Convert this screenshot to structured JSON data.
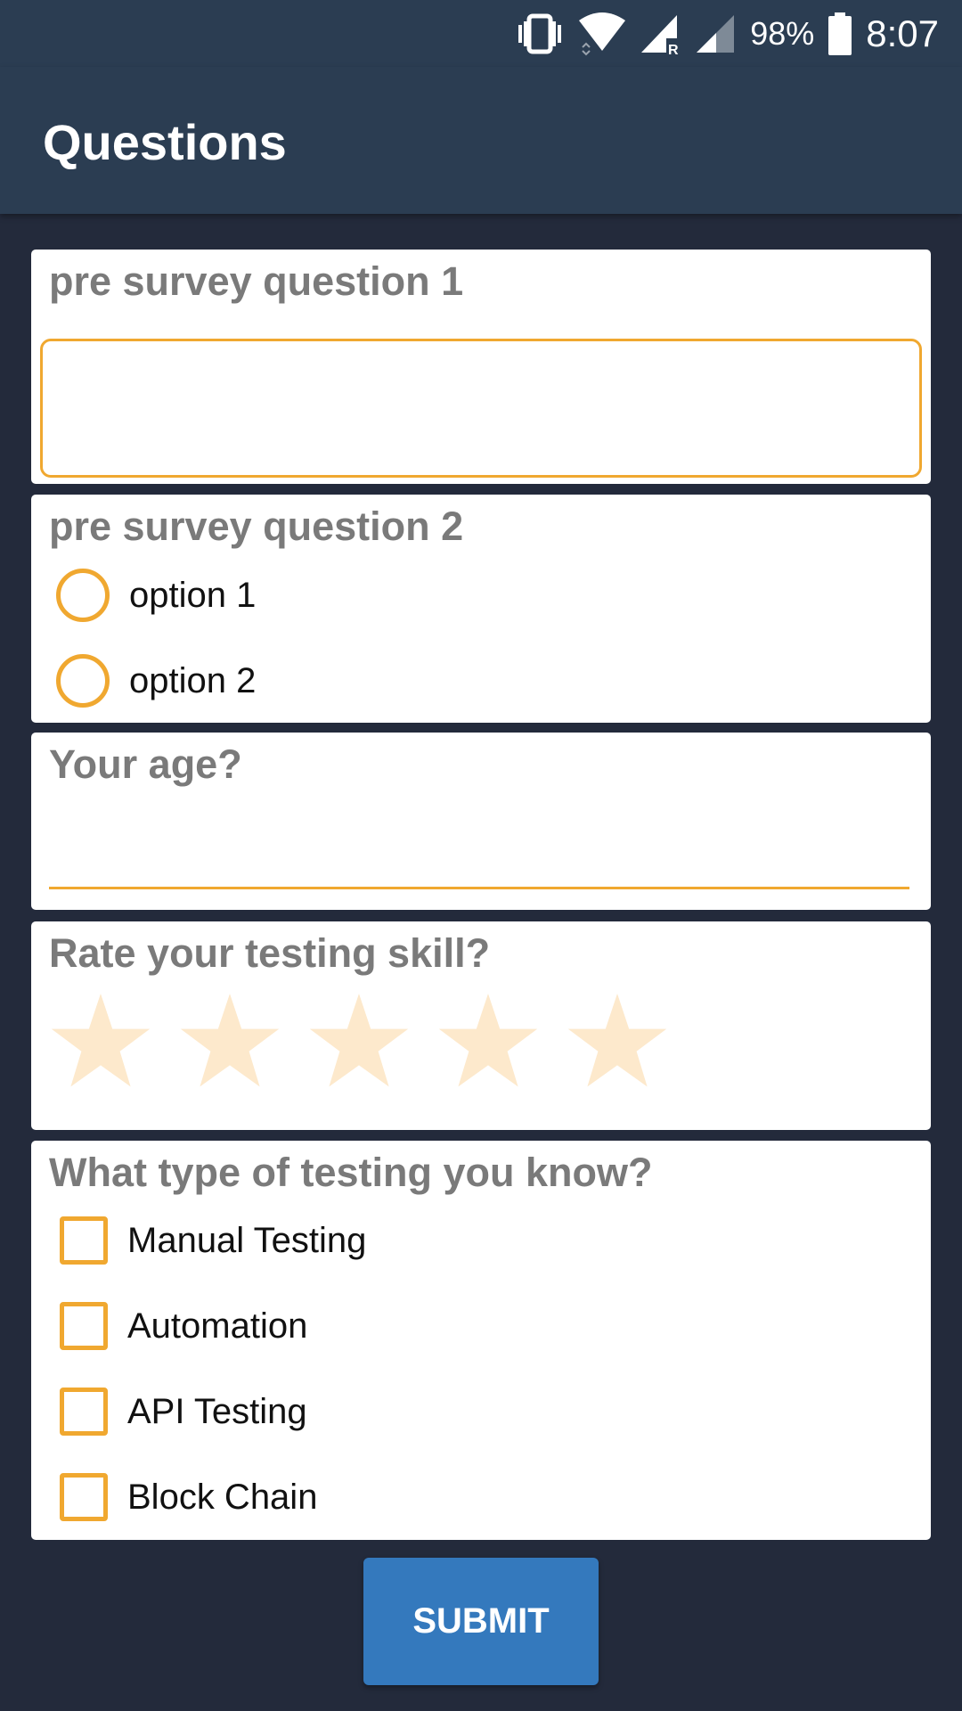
{
  "status_bar": {
    "battery_percent": "98%",
    "time": "8:07",
    "icons": [
      "vibrate-icon",
      "wifi-icon",
      "signal-roaming-icon",
      "signal-icon",
      "battery-icon"
    ]
  },
  "app_bar": {
    "title": "Questions"
  },
  "questions": {
    "q1": {
      "label": "pre survey question 1",
      "value": "",
      "placeholder": ""
    },
    "q2": {
      "label": "pre survey question 2",
      "options": [
        "option 1",
        "option 2"
      ],
      "selected": null
    },
    "q3": {
      "label": "Your age?",
      "value": "",
      "placeholder": ""
    },
    "q4": {
      "label": "Rate your testing skill?",
      "rating": 0,
      "max_rating": 5
    },
    "q5": {
      "label": "What type of testing you know?",
      "options": [
        "Manual Testing",
        "Automation",
        "API Testing",
        "Block Chain"
      ],
      "checked": []
    }
  },
  "submit_label": "SUBMIT",
  "colors": {
    "background": "#232a3b",
    "app_bar": "#2b3d52",
    "accent": "#f0a830",
    "star_empty": "#fde9cc",
    "button": "#3479bd",
    "label": "#7a7a7a"
  }
}
